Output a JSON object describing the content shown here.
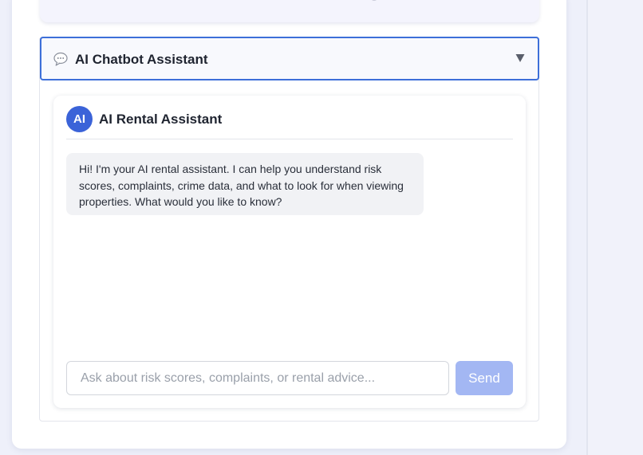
{
  "accordion": {
    "icon": "speech-bubble-icon",
    "title": "AI Chatbot Assistant",
    "toggle_icon": "triangle-down-icon",
    "expanded": true
  },
  "chat": {
    "avatar_text": "AI",
    "title": "AI Rental Assistant",
    "messages": [
      {
        "sender": "assistant",
        "text": "Hi! I'm your AI rental assistant. I can help you understand risk scores, complaints, crime data, and what to look for when viewing properties. What would you like to know?"
      }
    ],
    "input": {
      "value": "",
      "placeholder": "Ask about risk scores, complaints, or rental advice..."
    },
    "send_label": "Send"
  },
  "colors": {
    "accent": "#3d6fd9",
    "avatar_bg": "#3b63d8",
    "send_disabled": "#a3b7f3",
    "message_bg": "#f1f2f5",
    "page_bg": "#eef0fa"
  }
}
